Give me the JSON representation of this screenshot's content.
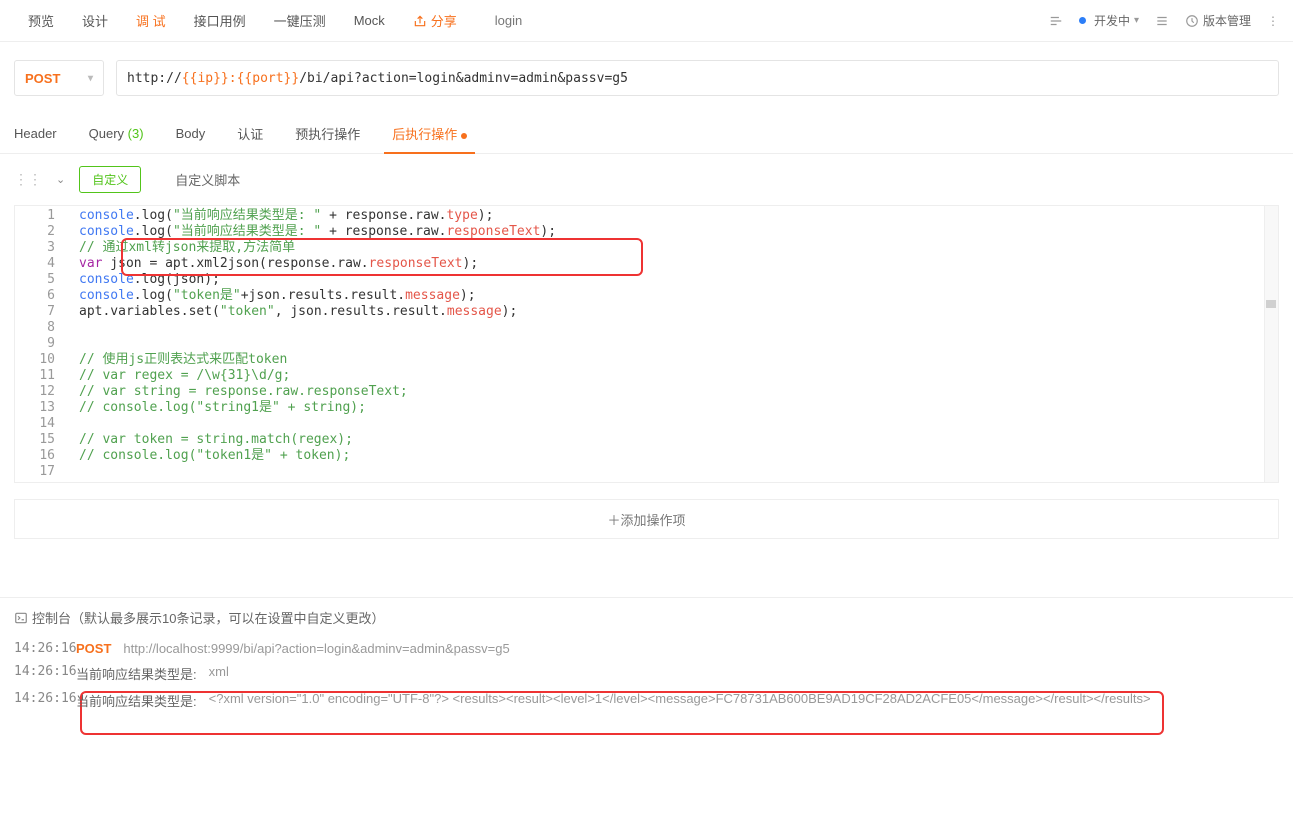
{
  "header": {
    "tabs": {
      "preview": "预览",
      "design": "设计",
      "debug": "调 试",
      "api_case": "接口用例",
      "pressure": "一键压测",
      "mock": "Mock",
      "share": "分享",
      "login": "login"
    },
    "status": "开发中",
    "version": "版本管理"
  },
  "url_bar": {
    "method": "POST",
    "url_prefix": "http://",
    "url_var": "{{ip}}:{{port}}",
    "url_suffix": "/bi/api?action=login&adminv=admin&passv=g5"
  },
  "sub_tabs": {
    "header": "Header",
    "query": "Query",
    "query_count": "(3)",
    "body": "Body",
    "auth": "认证",
    "pre_exec": "预执行操作",
    "post_exec": "后执行操作"
  },
  "script": {
    "custom_btn": "自定义",
    "label": "自定义脚本",
    "lines": [
      [
        [
          "fn",
          "console"
        ],
        [
          "",
          ".log"
        ],
        [
          "",
          "("
        ],
        [
          "str",
          "\"当前响应结果类型是: \""
        ],
        [
          "",
          " + response.raw."
        ],
        [
          "prop",
          "type"
        ],
        [
          "",
          ");"
        ]
      ],
      [
        [
          "fn",
          "console"
        ],
        [
          "",
          ".log"
        ],
        [
          "",
          "("
        ],
        [
          "str",
          "\"当前响应结果类型是: \""
        ],
        [
          "",
          " + response.raw."
        ],
        [
          "prop",
          "responseText"
        ],
        [
          "",
          ");"
        ]
      ],
      [
        [
          "cmt",
          "// 通过xml转json来提取,方法简单"
        ]
      ],
      [
        [
          "kw",
          "var"
        ],
        [
          "",
          " json = apt.xml2json(response.raw."
        ],
        [
          "prop",
          "responseText"
        ],
        [
          "",
          ");"
        ]
      ],
      [
        [
          "fn",
          "console"
        ],
        [
          "",
          ".log"
        ],
        [
          "",
          "(json);"
        ]
      ],
      [
        [
          "fn",
          "console"
        ],
        [
          "",
          ".log"
        ],
        [
          "",
          "("
        ],
        [
          "str",
          "\"token是\""
        ],
        [
          "",
          "+json.results.result."
        ],
        [
          "prop",
          "message"
        ],
        [
          "",
          ");"
        ]
      ],
      [
        [
          "",
          "apt.variables.set("
        ],
        [
          "str",
          "\"token\""
        ],
        [
          "",
          ", json.results.result."
        ],
        [
          "prop",
          "message"
        ],
        [
          "",
          ");"
        ]
      ],
      [
        [
          "",
          ""
        ]
      ],
      [
        [
          "",
          ""
        ]
      ],
      [
        [
          "cmt",
          "// 使用js正则表达式来匹配token"
        ]
      ],
      [
        [
          "cmt",
          "// var regex = /\\w{31}\\d/g;"
        ]
      ],
      [
        [
          "cmt",
          "// var string = response.raw.responseText;"
        ]
      ],
      [
        [
          "cmt",
          "// console.log(\"string1是\" + string);"
        ]
      ],
      [
        [
          "",
          ""
        ]
      ],
      [
        [
          "cmt",
          "// var token = string.match(regex);"
        ]
      ],
      [
        [
          "cmt",
          "// console.log(\"token1是\" + token);"
        ]
      ],
      [
        [
          "",
          ""
        ]
      ]
    ]
  },
  "add_op": "添加操作项",
  "console": {
    "title": "控制台（默认最多展示10条记录，可以在设置中自定义更改）",
    "rows": [
      {
        "time": "14:26:16",
        "method": "POST",
        "url": "http://localhost:9999/bi/api?action=login&adminv=admin&passv=g5"
      },
      {
        "time": "14:26:16",
        "label": "当前响应结果类型是:",
        "val": "xml"
      },
      {
        "time": "14:26:16",
        "label": "当前响应结果类型是:",
        "val": "<?xml version=\"1.0\" encoding=\"UTF-8\"?> <results><result><level>1</level><message>FC78731AB600BE9AD19CF28AD2ACFE05</message></result></results>"
      }
    ]
  }
}
